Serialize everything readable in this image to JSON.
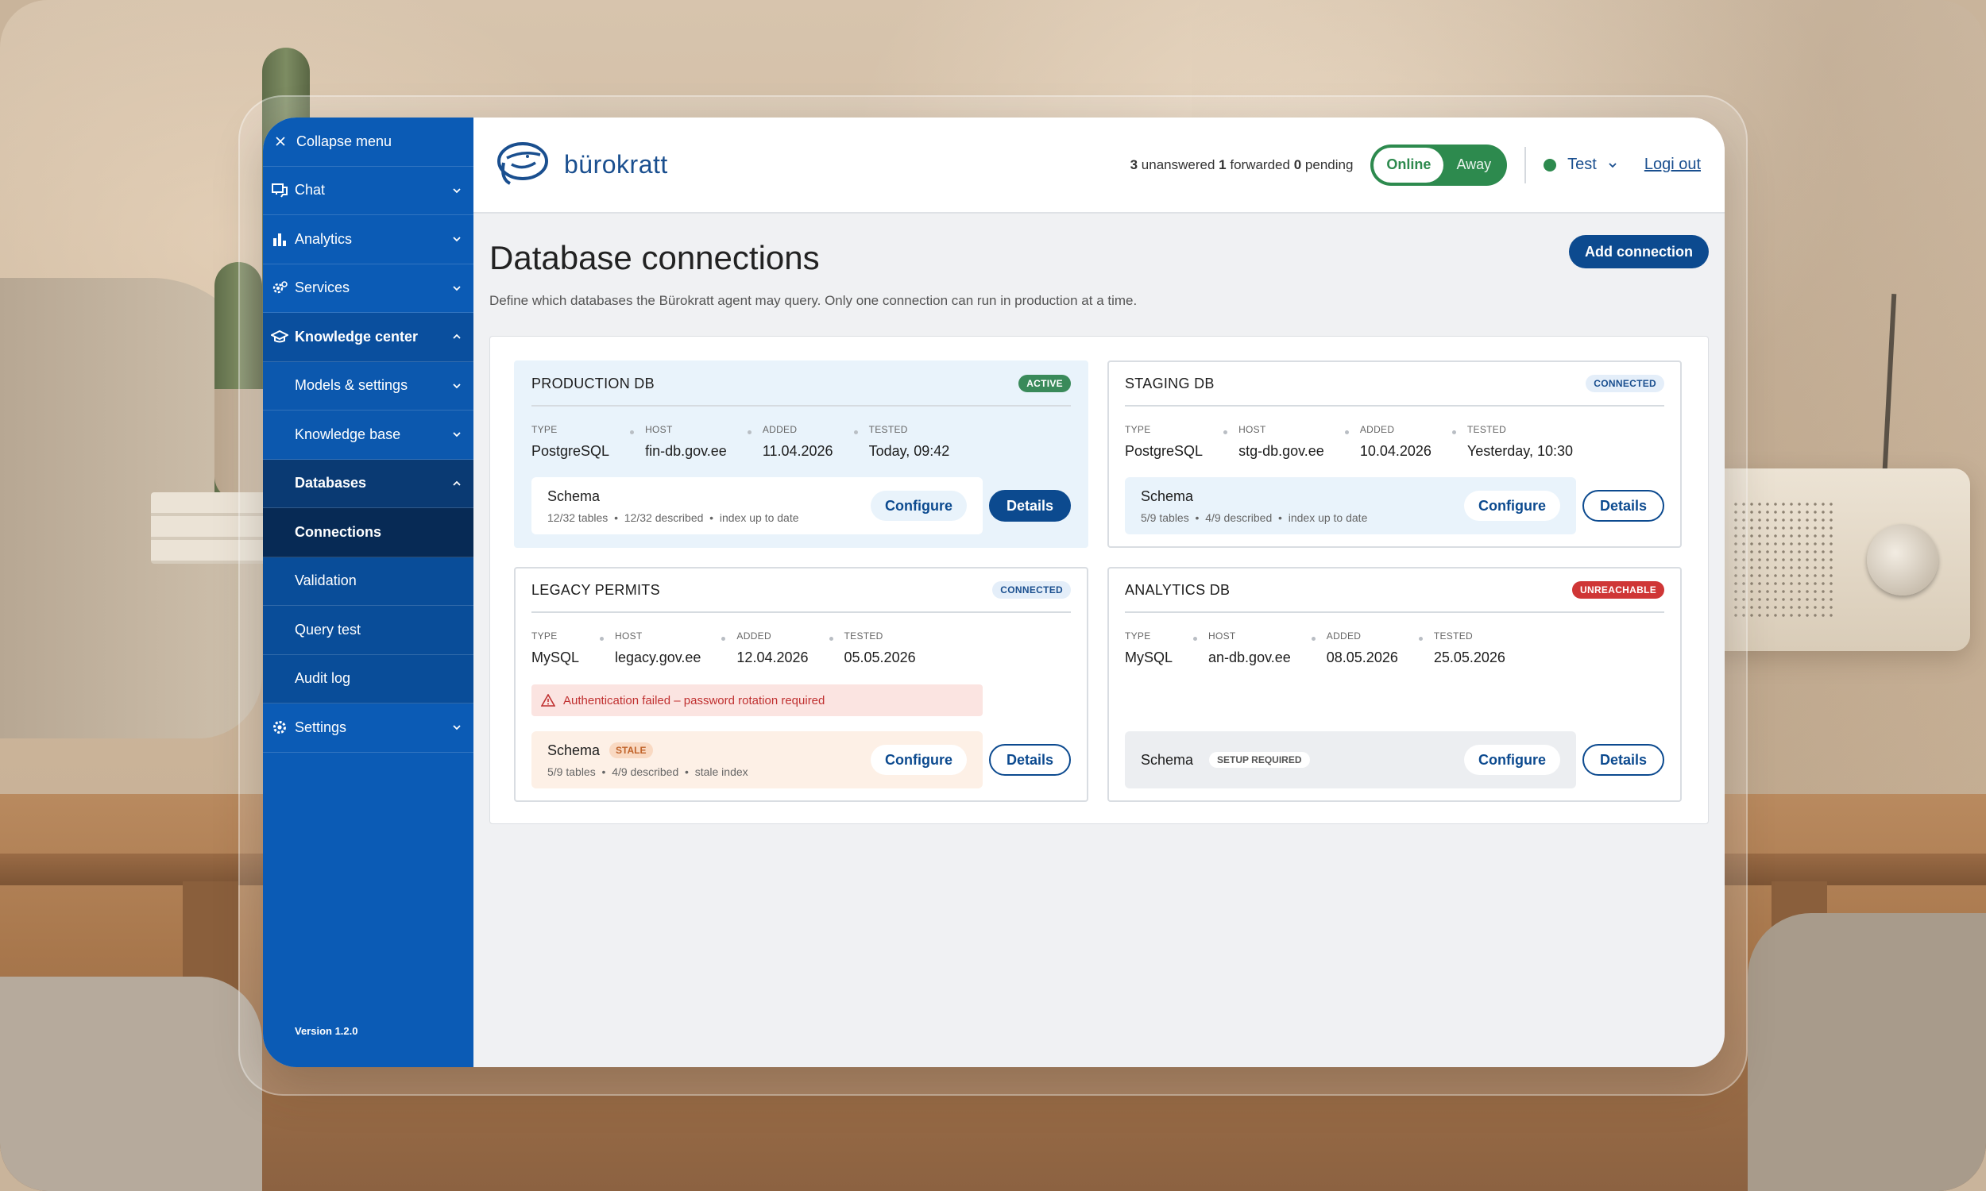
{
  "sidebar": {
    "collapse_label": "Collapse menu",
    "items": [
      {
        "label": "Chat"
      },
      {
        "label": "Analytics"
      },
      {
        "label": "Services"
      },
      {
        "label": "Knowledge center"
      },
      {
        "label": "Models & settings"
      },
      {
        "label": "Knowledge base"
      },
      {
        "label": "Databases"
      },
      {
        "label": "Connections"
      },
      {
        "label": "Validation"
      },
      {
        "label": "Query test"
      },
      {
        "label": "Audit log"
      },
      {
        "label": "Settings"
      }
    ],
    "version": "Version 1.2.0"
  },
  "header": {
    "brand": "bürokratt",
    "counts": {
      "unanswered": "3",
      "unanswered_label": "unanswered",
      "forwarded": "1",
      "forwarded_label": "forwarded",
      "pending": "0",
      "pending_label": "pending"
    },
    "status_online": "Online",
    "status_away": "Away",
    "user_name": "Test",
    "logout": "Logi out"
  },
  "page": {
    "title": "Database connections",
    "description": "Define which databases the Bürokratt agent may query. Only one connection can run in production at a time.",
    "add_button": "Add connection"
  },
  "meta_labels": {
    "type": "TYPE",
    "host": "HOST",
    "added": "ADDED",
    "tested": "TESTED"
  },
  "cards": [
    {
      "title": "PRODUCTION DB",
      "badge": "ACTIVE",
      "type": "PostgreSQL",
      "host": "fin-db.gov.ee",
      "added": "11.04.2026",
      "tested": "Today, 09:42",
      "schema_title": "Schema",
      "schema_tables": "12/32 tables",
      "schema_described": "12/32 described",
      "schema_index": "index up to date",
      "configure": "Configure",
      "details": "Details"
    },
    {
      "title": "STAGING DB",
      "badge": "CONNECTED",
      "type": "PostgreSQL",
      "host": "stg-db.gov.ee",
      "added": "10.04.2026",
      "tested": "Yesterday, 10:30",
      "schema_title": "Schema",
      "schema_tables": "5/9 tables",
      "schema_described": "4/9 described",
      "schema_index": "index up to date",
      "configure": "Configure",
      "details": "Details"
    },
    {
      "title": "LEGACY PERMITS",
      "badge": "CONNECTED",
      "type": "MySQL",
      "host": "legacy.gov.ee",
      "added": "12.04.2026",
      "tested": "05.05.2026",
      "error": "Authentication failed – password rotation required",
      "schema_title": "Schema",
      "schema_badge": "STALE",
      "schema_tables": "5/9 tables",
      "schema_described": "4/9 described",
      "schema_index": "stale index",
      "configure": "Configure",
      "details": "Details"
    },
    {
      "title": "ANALYTICS DB",
      "badge": "UNREACHABLE",
      "type": "MySQL",
      "host": "an-db.gov.ee",
      "added": "08.05.2026",
      "tested": "25.05.2026",
      "schema_title": "Schema",
      "schema_badge": "SETUP REQUIRED",
      "configure": "Configure",
      "details": "Details"
    }
  ],
  "colors": {
    "sidebar": "#0b5bb5",
    "primary": "#0c4a8f",
    "online": "#2d8a4e",
    "error": "#cf3636"
  }
}
